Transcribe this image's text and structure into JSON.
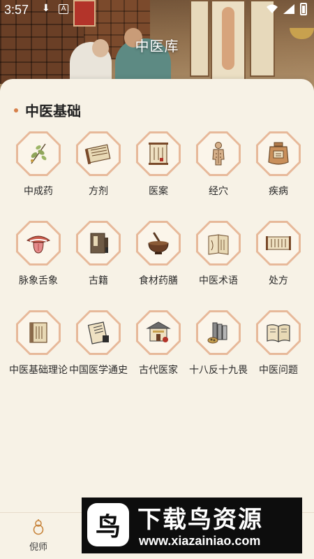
{
  "status": {
    "time": "3:57"
  },
  "hero": {
    "title": "中医库"
  },
  "section": {
    "title": "中医基础"
  },
  "categories": [
    {
      "label": "中成药",
      "icon": "herb-icon"
    },
    {
      "label": "方剂",
      "icon": "scroll-icon"
    },
    {
      "label": "医案",
      "icon": "document-icon"
    },
    {
      "label": "经穴",
      "icon": "acupoint-figure-icon"
    },
    {
      "label": "疾病",
      "icon": "jar-icon"
    },
    {
      "label": "脉象舌象",
      "icon": "tongue-icon"
    },
    {
      "label": "古籍",
      "icon": "ancient-book-icon"
    },
    {
      "label": "食材药膳",
      "icon": "mortar-icon"
    },
    {
      "label": "中医术语",
      "icon": "terminology-book-icon"
    },
    {
      "label": "处方",
      "icon": "prescription-icon"
    },
    {
      "label": "中医基础理论",
      "icon": "theory-book-icon"
    },
    {
      "label": "中国医学通史",
      "icon": "history-book-icon"
    },
    {
      "label": "古代医家",
      "icon": "pavilion-icon"
    },
    {
      "label": "十八反十九畏",
      "icon": "herbs-cans-icon"
    },
    {
      "label": "中医问题",
      "icon": "open-book-icon"
    }
  ],
  "bottom_nav": {
    "teacher_label": "倪师"
  },
  "watermark": {
    "title": "下载鸟资源",
    "url": "www.xiazainiao.com",
    "logo_char": "鸟"
  },
  "colors": {
    "accent": "#d6804a",
    "card_bg": "#f7f2e6",
    "icon_border": "#e7b99a"
  }
}
